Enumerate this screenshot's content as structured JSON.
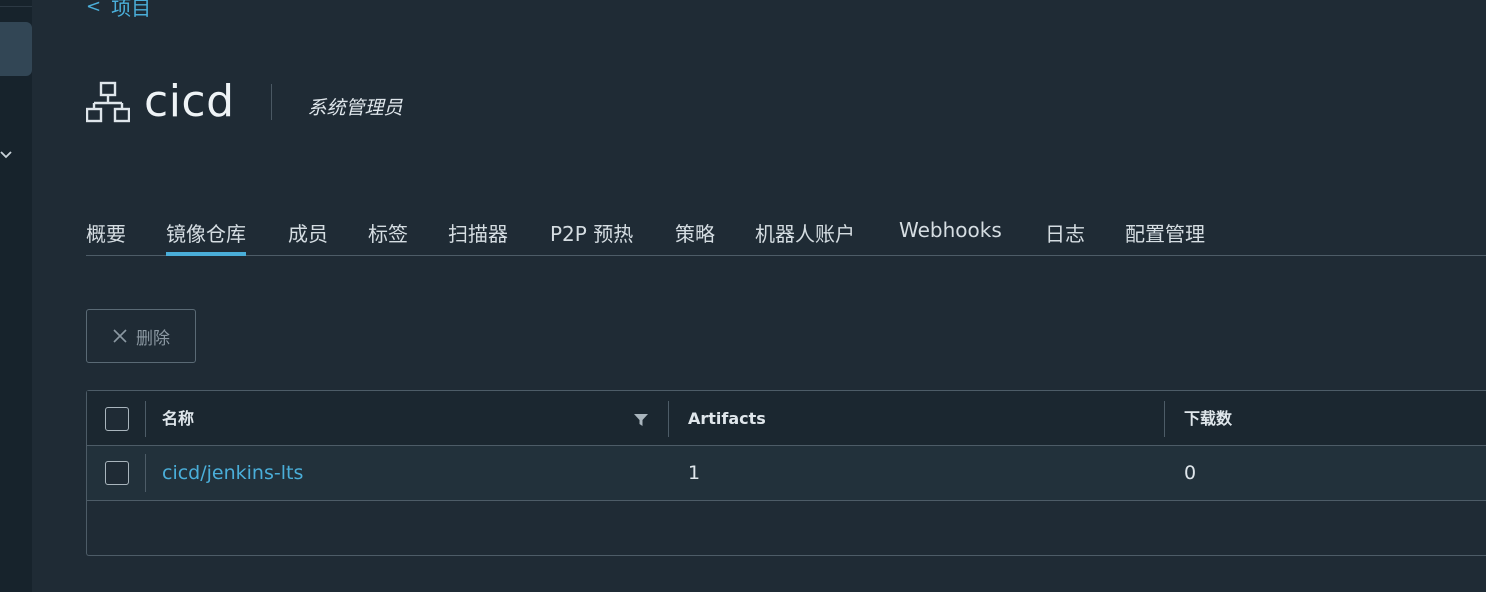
{
  "breadcrumb": {
    "chevron": "<",
    "label": "项目"
  },
  "project": {
    "name": "cicd",
    "role": "系统管理员",
    "icon": "project-network-icon"
  },
  "tabs": [
    {
      "label": "概要",
      "active": false
    },
    {
      "label": "镜像仓库",
      "active": true
    },
    {
      "label": "成员",
      "active": false
    },
    {
      "label": "标签",
      "active": false
    },
    {
      "label": "扫描器",
      "active": false
    },
    {
      "label": "P2P 预热",
      "active": false
    },
    {
      "label": "策略",
      "active": false
    },
    {
      "label": "机器人账户",
      "active": false
    },
    {
      "label": "Webhooks",
      "active": false
    },
    {
      "label": "日志",
      "active": false
    },
    {
      "label": "配置管理",
      "active": false
    }
  ],
  "toolbar": {
    "delete_label": "删除",
    "delete_icon": "close-icon"
  },
  "table": {
    "columns": [
      "名称",
      "Artifacts",
      "下载数"
    ],
    "rows": [
      {
        "name": "cicd/jenkins-lts",
        "artifacts": "1",
        "downloads": "0"
      }
    ]
  },
  "colors": {
    "accent": "#4aaed9",
    "background": "#1f2b35",
    "sidebar": "#17232c"
  }
}
